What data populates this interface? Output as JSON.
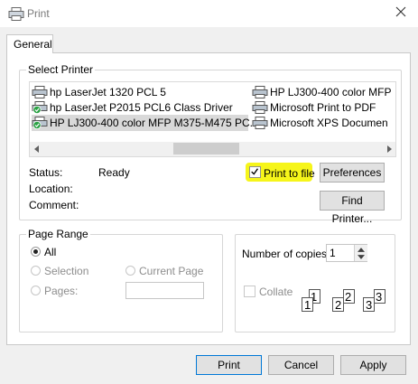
{
  "window": {
    "title": "Print",
    "icon": "printer-icon",
    "close_icon": "close-icon"
  },
  "tabs": [
    {
      "label": "General"
    }
  ],
  "select_printer": {
    "legend": "Select Printer",
    "printers": [
      {
        "name": "hp LaserJet 1320 PCL 5",
        "icon": "printer-icon",
        "selected": false,
        "default": false
      },
      {
        "name": "HP LJ300-400 color MFP",
        "icon": "printer-icon",
        "selected": false,
        "default": false
      },
      {
        "name": "hp LaserJet P2015 PCL6 Class Driver",
        "icon": "printer-check-icon",
        "selected": false,
        "default": true
      },
      {
        "name": "Microsoft Print to PDF",
        "icon": "printer-icon",
        "selected": false,
        "default": false
      },
      {
        "name": "HP LJ300-400 color MFP M375-M475 PC...",
        "icon": "printer-check-icon",
        "selected": true,
        "default": true
      },
      {
        "name": "Microsoft XPS Documen",
        "icon": "printer-icon",
        "selected": false,
        "default": false
      }
    ],
    "status_label": "Status:",
    "status_value": "Ready",
    "location_label": "Location:",
    "comment_label": "Comment:",
    "print_to_file_label": "Print to file",
    "print_to_file_checked": true,
    "highlight_color": "#f6f51a",
    "preferences_label": "Preferences",
    "find_printer_label": "Find Printer..."
  },
  "page_range": {
    "legend": "Page Range",
    "all_label": "All",
    "selection_label": "Selection",
    "current_page_label": "Current Page",
    "pages_label": "Pages:",
    "pages_value": "",
    "selected": "All"
  },
  "copies": {
    "label": "Number of copies:",
    "value": "1",
    "collate_label": "Collate",
    "collate_checked": false,
    "pages": [
      {
        "back": "1",
        "front": "1"
      },
      {
        "back": "2",
        "front": "2"
      },
      {
        "back": "3",
        "front": "3"
      }
    ]
  },
  "buttons": {
    "print": "Print",
    "cancel": "Cancel",
    "apply": "Apply"
  }
}
